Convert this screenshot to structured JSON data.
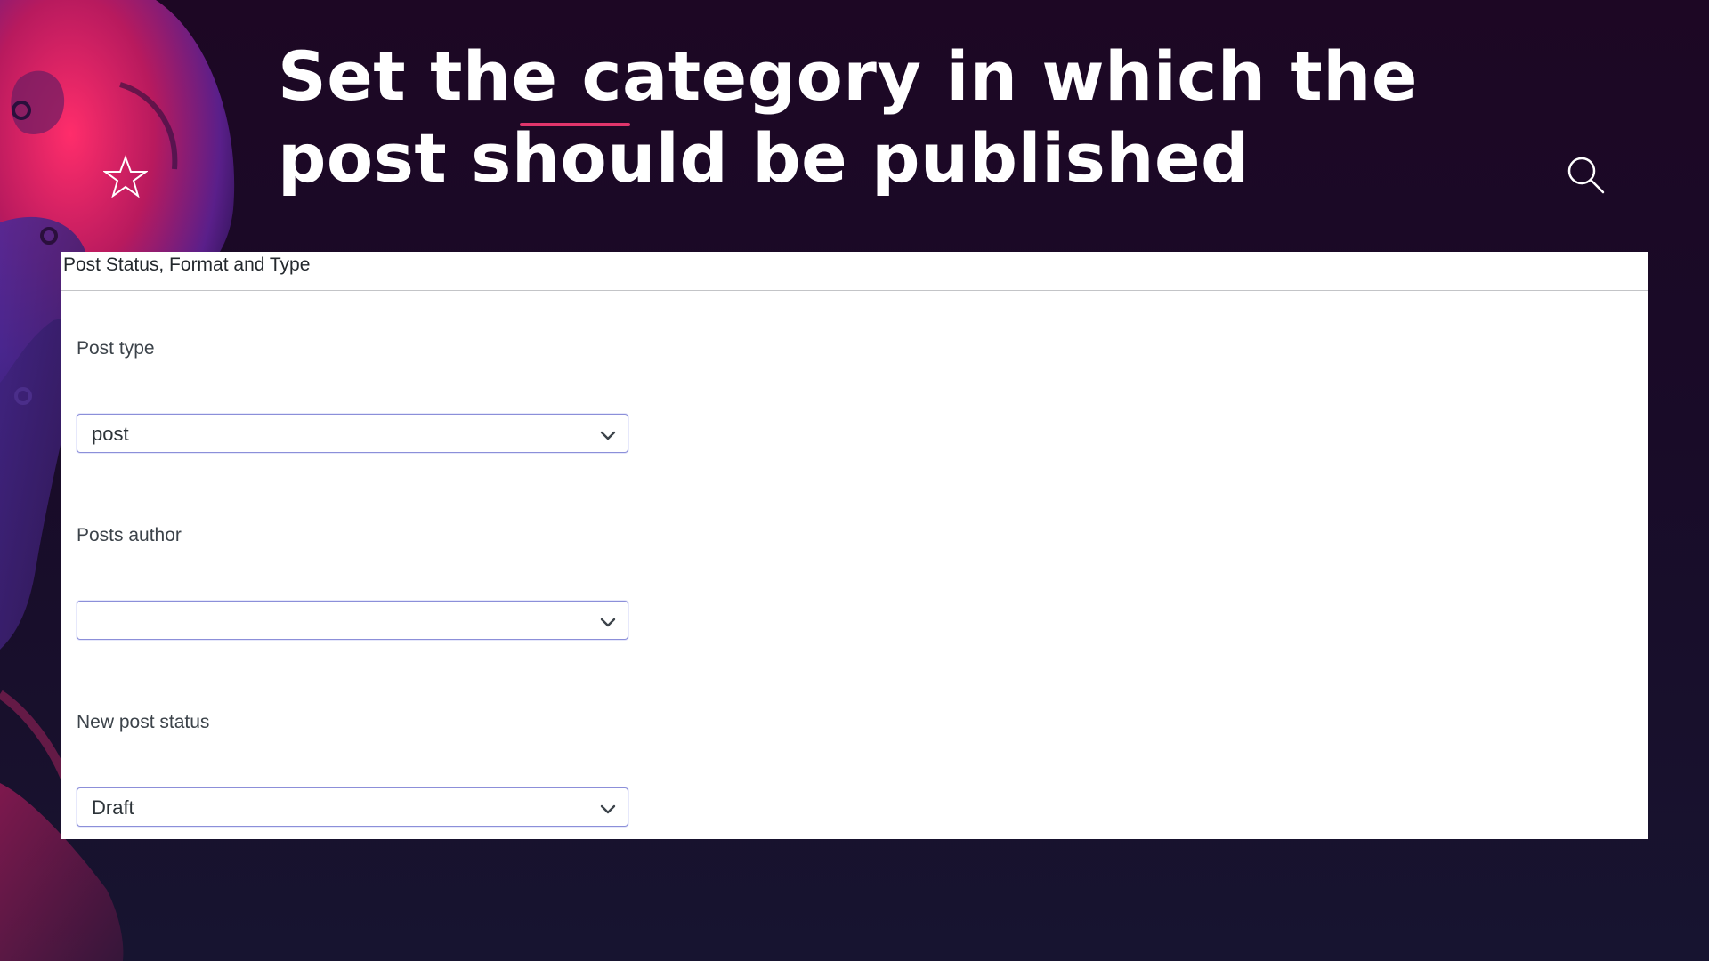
{
  "slide": {
    "title_line1": "Set the category in which the",
    "title_line2": "post should be published",
    "accent_color": "#e0356b",
    "icons": [
      "star-icon",
      "search-icon"
    ]
  },
  "panel": {
    "header": "Post Status, Format and Type",
    "fields": [
      {
        "label": "Post type",
        "value": "post"
      },
      {
        "label": "Posts author",
        "value": ""
      },
      {
        "label": "New post status",
        "value": "Draft"
      }
    ]
  }
}
